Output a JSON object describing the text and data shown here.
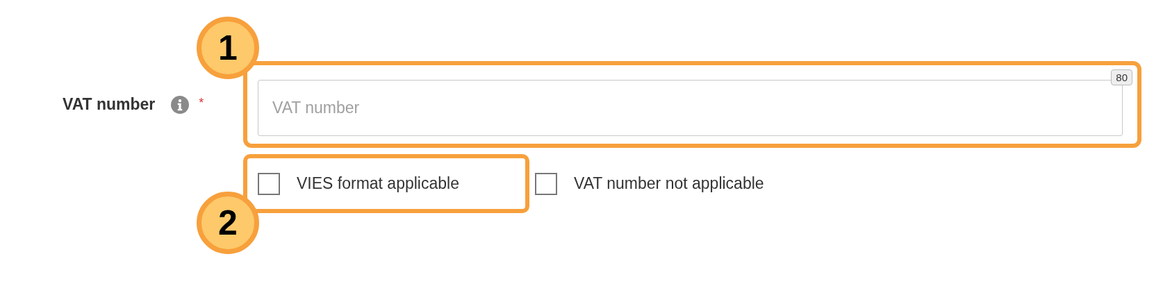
{
  "field": {
    "label": "VAT number",
    "required_mark": "*",
    "placeholder": "VAT number",
    "char_counter": "80"
  },
  "checkboxes": [
    {
      "label": "VIES format applicable",
      "checked": false
    },
    {
      "label": "VAT number not applicable",
      "checked": false
    }
  ],
  "callouts": [
    {
      "number": "1"
    },
    {
      "number": "2"
    }
  ]
}
